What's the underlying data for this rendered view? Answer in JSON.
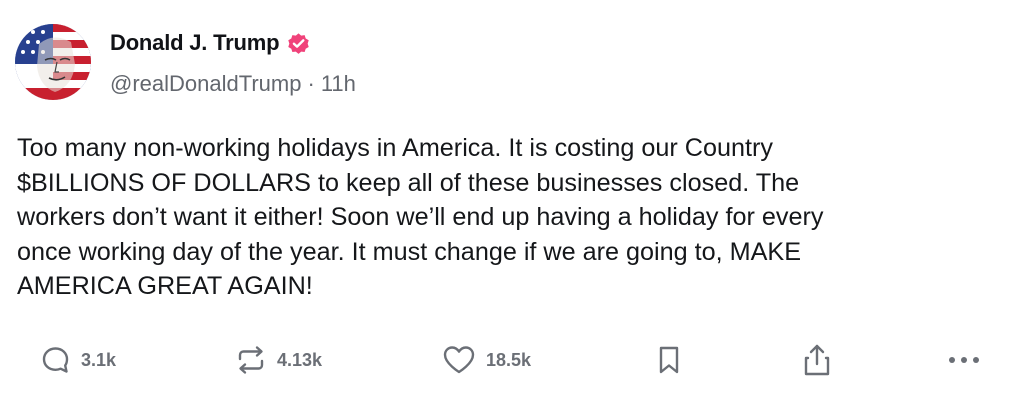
{
  "author": {
    "display_name": "Donald J. Trump",
    "handle": "@realDonaldTrump",
    "separator": "·",
    "time_ago": "11h",
    "verified_color": "#f0427a"
  },
  "post": {
    "text": "Too many non-working holidays in America. It is costing our Country\n$BILLIONS OF DOLLARS to keep all of these businesses closed. The\nworkers don’t want it either! Soon we’ll end up having a holiday for every\nonce working day of the year. It must change if we are going to, MAKE\nAMERICA GREAT AGAIN!"
  },
  "actions": {
    "reply": {
      "icon": "reply-icon",
      "count": "3.1k"
    },
    "repost": {
      "icon": "repost-icon",
      "count": "4.13k"
    },
    "like": {
      "icon": "heart-icon",
      "count": "18.5k"
    },
    "bookmark": {
      "icon": "bookmark-icon"
    },
    "share": {
      "icon": "share-icon"
    },
    "more": {
      "icon": "more-icon"
    }
  },
  "colors": {
    "text": "#15171a",
    "muted": "#63676e",
    "icon": "#6b6f76",
    "background": "#ffffff"
  }
}
